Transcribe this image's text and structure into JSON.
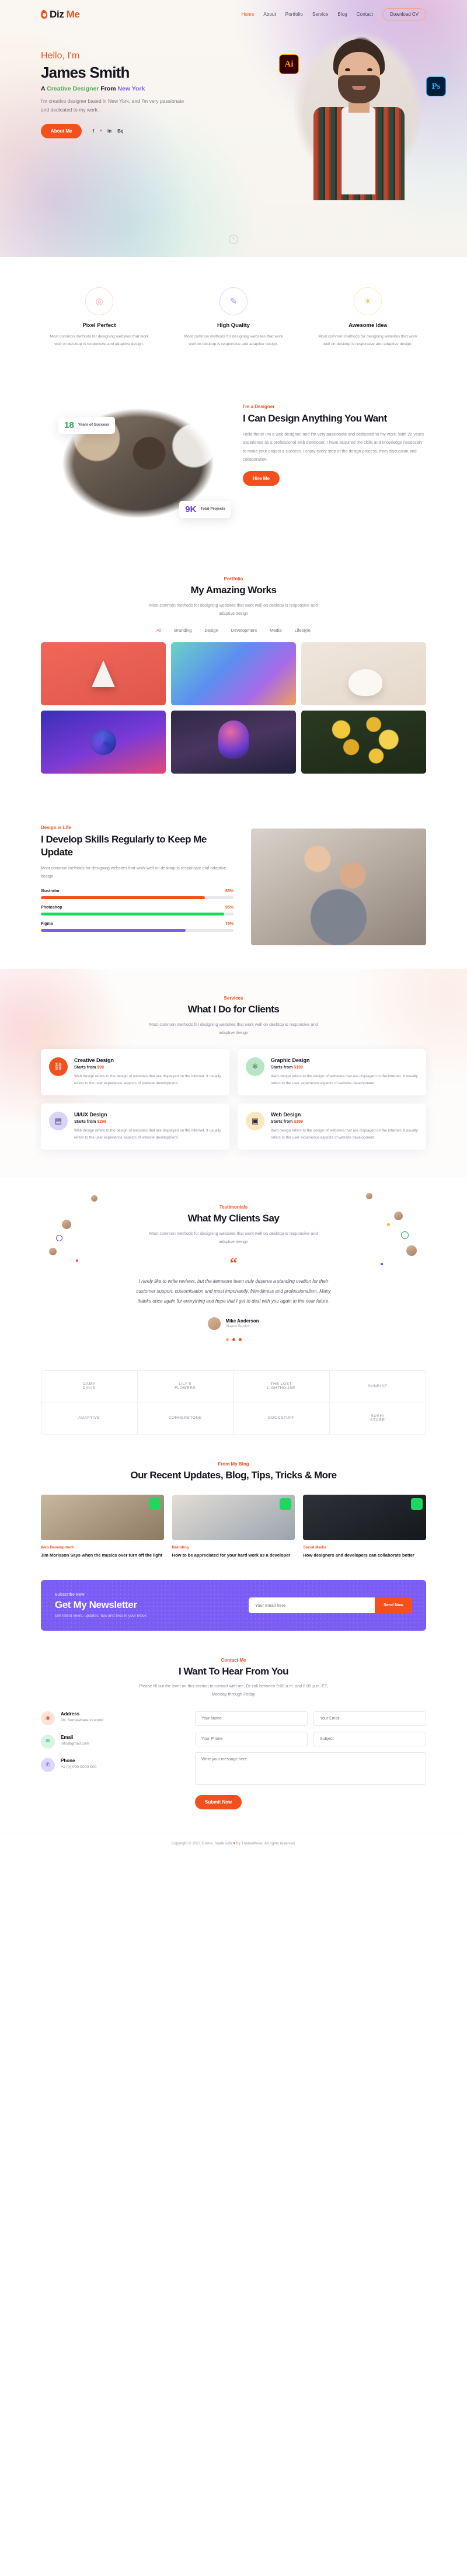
{
  "header": {
    "logo_text_1": "Diz",
    "logo_text_2": "Me",
    "nav": [
      {
        "label": "Home",
        "active": true
      },
      {
        "label": "About",
        "active": false
      },
      {
        "label": "Portfolio",
        "active": false
      },
      {
        "label": "Service",
        "active": false
      },
      {
        "label": "Blog",
        "active": false
      },
      {
        "label": "Contact",
        "active": false
      }
    ],
    "cv_button": "Download CV"
  },
  "hero": {
    "hello": "Hello, I'm",
    "name": "James Smith",
    "sub_a": "A ",
    "sub_role": "Creative Designer",
    "sub_b": " From ",
    "sub_city": "New York",
    "desc": "I'm creative designer based in New York, and I'm very passionate and dedicated to my work.",
    "cta": "About Me",
    "socials": [
      "f",
      "ᵛ",
      "in",
      "Bę"
    ],
    "badge_ai": "Ai",
    "badge_ps": "Ps",
    "scroll_hint": "°"
  },
  "features": [
    {
      "icon": "target-icon",
      "glyph": "◎",
      "title": "Pixel Perfect",
      "desc": "Most common methods for designing websites that work well on desktop is responsive and adaptive design."
    },
    {
      "icon": "brush-icon",
      "glyph": "✎",
      "title": "High Quality",
      "desc": "Most common methods for designing websites that work well on desktop is responsive and adaptive design."
    },
    {
      "icon": "bulb-icon",
      "glyph": "☀",
      "title": "Awesome Idea",
      "desc": "Most common methods for designing websites that work well on desktop is responsive and adaptive design."
    }
  ],
  "about": {
    "eyebrow": "I'm a Designer",
    "title": "I Can Design Anything You Want",
    "desc": "Hello there! I'm a web designer, and I'm very passionate and dedicated to my work. With 20 years experience as a professional web developer, I have acquired the skills and knowledge necessary to make your project a success. I enjoy every step of the design process, from discussion and collaboration.",
    "cta": "Hire Me",
    "stats": [
      {
        "num": "18",
        "label": "Years of Success",
        "color": "#1ea84c"
      },
      {
        "num": "9K",
        "label": "Total Projects",
        "color": "#6b3df0"
      }
    ]
  },
  "portfolio": {
    "eyebrow": "Portfolio",
    "title": "My Amazing Works",
    "sub": "Most common methods for designing websites that work well on desktop is responsive and adaptive design",
    "filters": [
      {
        "label": "All",
        "active": true
      },
      {
        "label": "Branding",
        "active": false
      },
      {
        "label": "Design",
        "active": false
      },
      {
        "label": "Development",
        "active": false
      },
      {
        "label": "Media",
        "active": false
      },
      {
        "label": "Lifestyle",
        "active": false
      }
    ]
  },
  "skills": {
    "eyebrow": "Design is Life",
    "title": "I Develop Skills Regularly to Keep Me Update",
    "desc": "Most common methods for designing websites that work well on desktop is responsive and adaptive design",
    "bars": [
      {
        "name": "Illustrator",
        "pct": "85%",
        "value": 85,
        "color": "#f4501e"
      },
      {
        "name": "Photoshop",
        "pct": "95%",
        "value": 95,
        "color": "#1ed760"
      },
      {
        "name": "Figma",
        "pct": "75%",
        "value": 75,
        "color": "#7b5cf5"
      }
    ]
  },
  "services": {
    "eyebrow": "Services",
    "title": "What I Do for Clients",
    "sub": "Most common methods for designing websites that work well on desktop is responsive and adaptive design",
    "cards": [
      {
        "icon": "node-network-icon",
        "glyph": "⛓",
        "title": "Creative Design",
        "price_prefix": "Starts from ",
        "price": "$99",
        "desc": "Web design refers to the design of websites that are displayed on the internet. It usually refers to the user experience aspects of website development.",
        "tone": "o"
      },
      {
        "icon": "atom-icon",
        "glyph": "⚛",
        "title": "Graphic Design",
        "price_prefix": "Starts from ",
        "price": "$199",
        "desc": "Web design refers to the design of websites that are displayed on the internet. It usually refers to the user experience aspects of website development.",
        "tone": "g"
      },
      {
        "icon": "id-card-icon",
        "glyph": "▤",
        "title": "UI/UX Design",
        "price_prefix": "Starts from ",
        "price": "$299",
        "desc": "Web design refers to the design of websites that are displayed on the internet. It usually refers to the user experience aspects of website development.",
        "tone": "p"
      },
      {
        "icon": "browser-window-icon",
        "glyph": "▣",
        "title": "Web Design",
        "price_prefix": "Starts from ",
        "price": "$399",
        "desc": "Web design refers to the design of websites that are displayed on the internet. It usually refers to the user experience aspects of website development.",
        "tone": "y"
      }
    ]
  },
  "testimonials": {
    "eyebrow": "Testimonials",
    "title": "What My Clients Say",
    "sub": "Most common methods for designing websites that work well on desktop is responsive and adaptive design",
    "quote_mark": "“",
    "quote": "I rarely like to write reviews, but the itemstore team truly deserve a standing ovation for their customer support, customisation and most importantly, friendliness and professionalism. Many thanks once again for everything and hope that I get to deal with you again in the near future.",
    "author_name": "Mike Anderson",
    "author_role": "Vivaco Studio"
  },
  "brands": [
    {
      "label": "CAMP\nDAVID"
    },
    {
      "label": "LILY'S\nFLOWERS"
    },
    {
      "label": "THE LOST\nLIGHTHOUSE"
    },
    {
      "label": "SUNRISE"
    },
    {
      "label": "ADAPTIVE"
    },
    {
      "label": "CORNERSTONE"
    },
    {
      "label": "GOODSTUFF"
    },
    {
      "label": "SUSHI\nSTORE"
    }
  ],
  "blog": {
    "eyebrow": "From My Blog",
    "title": "Our Recent Updates, Blog, Tips, Tricks & More",
    "posts": [
      {
        "category": "Web Development",
        "title": "Jim Morisson Says when the musics over turn off the light"
      },
      {
        "category": "Branding",
        "title": "How to be appreciated for your hard work as a developer"
      },
      {
        "category": "Social Media",
        "title": "How designers and developers can collaborate better"
      }
    ]
  },
  "newsletter": {
    "eyebrow": "Subscribe Now",
    "title": "Get My Newsletter",
    "sub": "Get latest news, updates, tips and trics in your inbox",
    "placeholder": "Your email here",
    "button": "Send Now"
  },
  "contact": {
    "eyebrow": "Contact Me",
    "title": "I Want To Hear From You",
    "sub": "Please fill out the form on this section to contact with me. Or call between 9:00 a.m. and 8:00 p.m. ET, Monday through Friday",
    "items": [
      {
        "icon": "location-pin-icon",
        "glyph": "◉",
        "label": "Address",
        "value": "20, Somewhere in world",
        "tone": "a"
      },
      {
        "icon": "envelope-icon",
        "glyph": "✉",
        "label": "Email",
        "value": "info@gmail.com",
        "tone": "e"
      },
      {
        "icon": "phone-icon",
        "glyph": "✆",
        "label": "Phone",
        "value": "+1 (0) 000 0000 000",
        "tone": "p"
      }
    ],
    "fields": {
      "name": "Your Name",
      "email": "Your Email",
      "phone": "Your Phone",
      "subject": "Subject",
      "message": "Write your message here"
    },
    "submit": "Submit Now"
  },
  "footer": {
    "copyright_a": "Copyright © 2021 Dizme. made with ",
    "copyright_heart": "♥",
    "copyright_b": " by ThemeMove. All rights reserved."
  }
}
